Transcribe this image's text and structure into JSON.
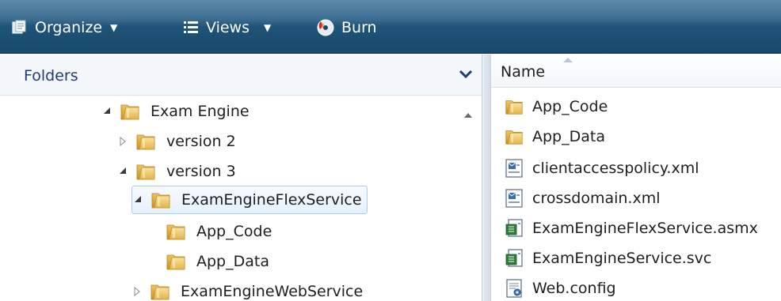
{
  "toolbar": {
    "organize_label": "Organize",
    "views_label": "Views",
    "burn_label": "Burn"
  },
  "folders_pane": {
    "title": "Folders",
    "tree": [
      {
        "label": "Exam Engine",
        "state": "expanded",
        "selected": false
      },
      {
        "label": "version 2",
        "state": "collapsed",
        "selected": false
      },
      {
        "label": "version 3",
        "state": "expanded",
        "selected": false
      },
      {
        "label": "ExamEngineFlexService",
        "state": "expanded",
        "selected": true
      },
      {
        "label": "App_Code",
        "state": "none",
        "selected": false
      },
      {
        "label": "App_Data",
        "state": "none",
        "selected": false
      },
      {
        "label": "ExamEngineWebService",
        "state": "collapsed",
        "selected": false
      }
    ]
  },
  "file_pane": {
    "column_name": "Name",
    "files": [
      {
        "label": "App_Code",
        "icon": "folder-icon"
      },
      {
        "label": "App_Data",
        "icon": "folder-icon"
      },
      {
        "label": "clientaccesspolicy.xml",
        "icon": "xml-file-icon"
      },
      {
        "label": "crossdomain.xml",
        "icon": "xml-file-icon"
      },
      {
        "label": "ExamEngineFlexService.asmx",
        "icon": "web-service-file-icon"
      },
      {
        "label": "ExamEngineService.svc",
        "icon": "web-service-file-icon"
      },
      {
        "label": "Web.config",
        "icon": "config-file-icon"
      }
    ]
  },
  "colors": {
    "toolbar_top": "#5f8aa9",
    "toolbar_bottom": "#17496b",
    "folders_title": "#1e3d78",
    "selection_border": "#a9cdf2"
  }
}
